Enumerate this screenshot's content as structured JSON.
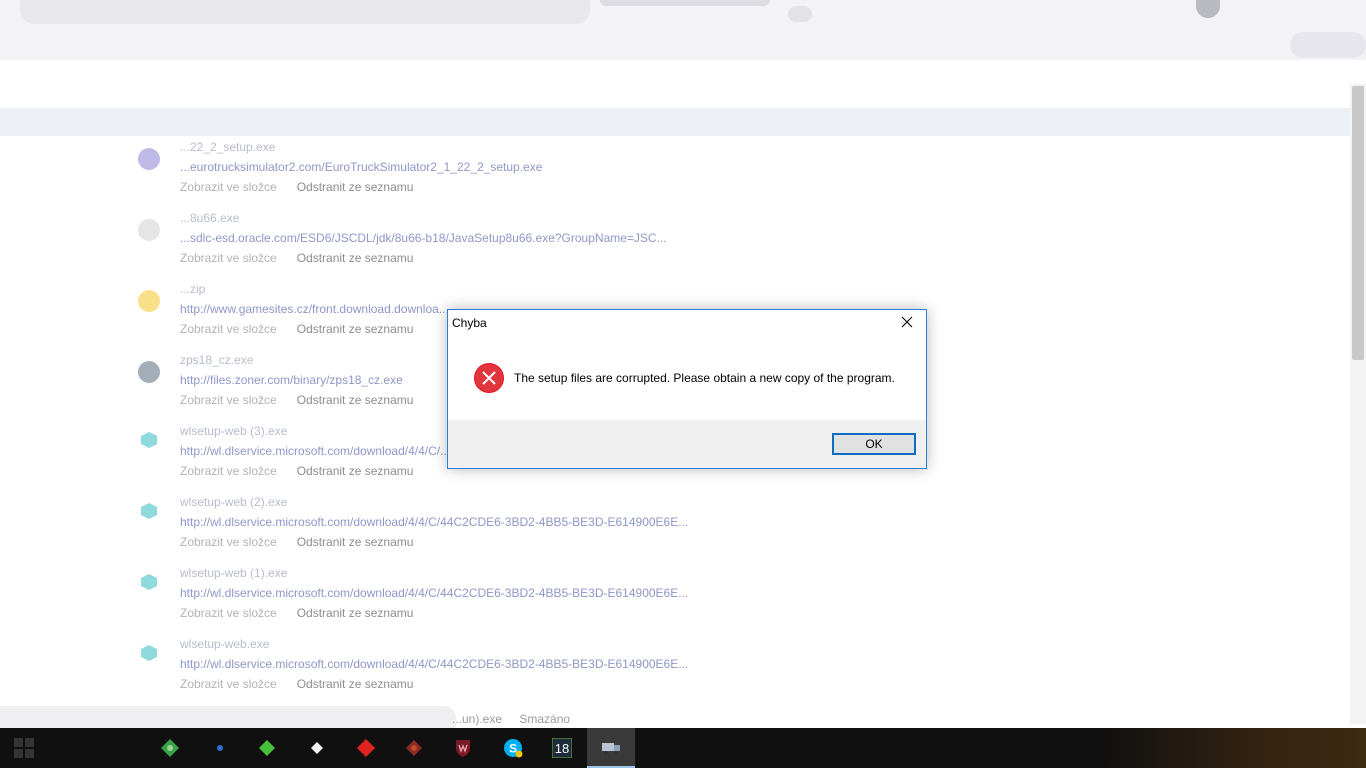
{
  "dialog": {
    "title": "Chyba",
    "message": "The setup files are corrupted. Please obtain a new copy of the program.",
    "ok_label": "OK",
    "error_icon": "error-x-icon",
    "close_icon": "close-icon"
  },
  "downloads": [
    {
      "name": "...22_2_setup.exe",
      "url": "...eurotrucksimulator2.com/EuroTruckSimulator2_1_22_2_setup.exe",
      "show": "Zobrazit ve složce",
      "remove": "Odstranit ze seznamu"
    },
    {
      "name": "...8u66.exe",
      "url": "...sdlc-esd.oracle.com/ESD6/JSCDL/jdk/8u66-b18/JavaSetup8u66.exe?GroupName=JSC...",
      "show": "Zobrazit ve složce",
      "remove": "Odstranit ze seznamu"
    },
    {
      "name": "...zip",
      "url": "http://www.gamesites.cz/front.download.downloa...",
      "show": "Zobrazit ve složce",
      "remove": "Odstranit ze seznamu"
    },
    {
      "name": "zps18_cz.exe",
      "url": "http://files.zoner.com/binary/zps18_cz.exe",
      "show": "Zobrazit ve složce",
      "remove": "Odstranit ze seznamu"
    },
    {
      "name": "wlsetup-web (3).exe",
      "url": "http://wl.dlservice.microsoft.com/download/4/4/C/...",
      "show": "Zobrazit ve složce",
      "remove": "Odstranit ze seznamu"
    },
    {
      "name": "wlsetup-web (2).exe",
      "url": "http://wl.dlservice.microsoft.com/download/4/4/C/44C2CDE6-3BD2-4BB5-BE3D-E614900E6E...",
      "show": "Zobrazit ve složce",
      "remove": "Odstranit ze seznamu"
    },
    {
      "name": "wlsetup-web (1).exe",
      "url": "http://wl.dlservice.microsoft.com/download/4/4/C/44C2CDE6-3BD2-4BB5-BE3D-E614900E6E...",
      "show": "Zobrazit ve složce",
      "remove": "Odstranit ze seznamu"
    },
    {
      "name": "wlsetup-web.exe",
      "url": "http://wl.dlservice.microsoft.com/download/4/4/C/44C2CDE6-3BD2-4BB5-BE3D-E614900E6E...",
      "show": "Zobrazit ve složce",
      "remove": "Odstranit ze seznamu"
    }
  ],
  "bottom_item": {
    "name": "...un).exe",
    "status": "Smazáno"
  },
  "taskbar": {
    "icons": [
      "start-icon",
      "green-app-icon",
      "blue-dot-icon",
      "diamond-green-icon",
      "diamond-white-icon",
      "diamond-red-icon",
      "diamond-darkred-icon",
      "red-shield-icon",
      "skype-icon",
      "zoner-18-icon",
      "setup-truck-icon"
    ],
    "zoner_label": "18",
    "accent": "#9fc3e8"
  },
  "colors": {
    "dialog_border": "#2c7fd6",
    "ok_border": "#0f6cc4",
    "error_red": "#e81123"
  }
}
